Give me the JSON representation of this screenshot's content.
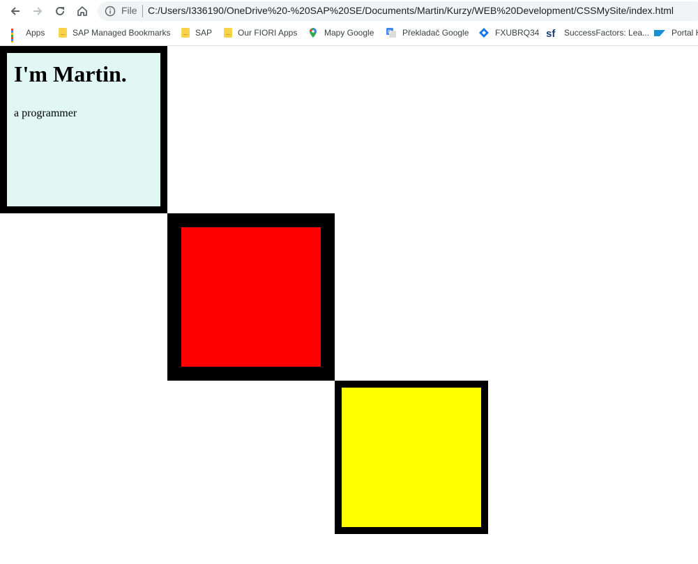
{
  "browser": {
    "address_bar": {
      "scheme_label": "File",
      "url": "C:/Users/I336190/OneDrive%20-%20SAP%20SE/Documents/Martin/Kurzy/WEB%20Development/CSSMySite/index.html"
    },
    "bookmarks": [
      {
        "label": "Apps",
        "icon": "apps-grid-icon"
      },
      {
        "label": "SAP Managed Bookmarks",
        "icon": "folder-icon"
      },
      {
        "label": "SAP",
        "icon": "folder-icon"
      },
      {
        "label": "Our FIORI Apps",
        "icon": "folder-icon"
      },
      {
        "label": "Mapy Google",
        "icon": "map-pin-icon"
      },
      {
        "label": "Překladač Google",
        "icon": "translate-icon"
      },
      {
        "label": "FXUBRQ34",
        "icon": "diamond-icon"
      },
      {
        "label": "SuccessFactors: Lea...",
        "icon": "sf-logo-icon"
      },
      {
        "label": "Portal H",
        "icon": "sap-logo-icon"
      }
    ]
  },
  "page": {
    "heading": "I'm Martin.",
    "subtitle": "a programmer",
    "box_colors": {
      "box_1": "#e0f7f3",
      "box_2": "#ff0000",
      "box_3": "#ffff00",
      "border": "#000000"
    }
  }
}
